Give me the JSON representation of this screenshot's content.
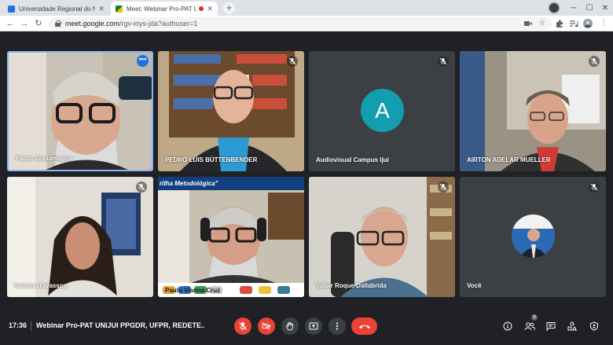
{
  "browser": {
    "tabs": [
      {
        "title": "Universidade Regional do Noroeste",
        "favicon_color": "#1a73e8"
      },
      {
        "title": "Meet: Webinar Pro-PAT UNIJUÍ",
        "favicon_color": "#00832d",
        "recording": true
      }
    ],
    "address": {
      "host": "meet.google.com",
      "path": "/rgv-ioys-jda?authuser=1"
    }
  },
  "participants": [
    {
      "name": "Pablo Costamagna",
      "pinned": true
    },
    {
      "name": "PEDRO LUIS BÜTTENBENDER"
    },
    {
      "name": "Audiovisual Campus Ijuí",
      "avatar_letter": "A",
      "avatar_color": "#129eaf"
    },
    {
      "name": "AIRTON ADELAR MUELLER"
    },
    {
      "name": "luciana travassos"
    },
    {
      "name": "Paulo Vianna Cruz",
      "slide_title": "rilha Metodológica\""
    },
    {
      "name": "Valdir Roque Dallabrida"
    },
    {
      "name": "Você"
    }
  ],
  "bottom_bar": {
    "time": "17:36",
    "meeting_title": "Webinar Pro-PAT UNIJUI PPGDR, UFPR, REDETE...",
    "participant_count": "8"
  },
  "colors": {
    "accent": "#8ab4f8",
    "danger": "#ea4335",
    "background": "#202124",
    "tile": "#3c4043"
  }
}
